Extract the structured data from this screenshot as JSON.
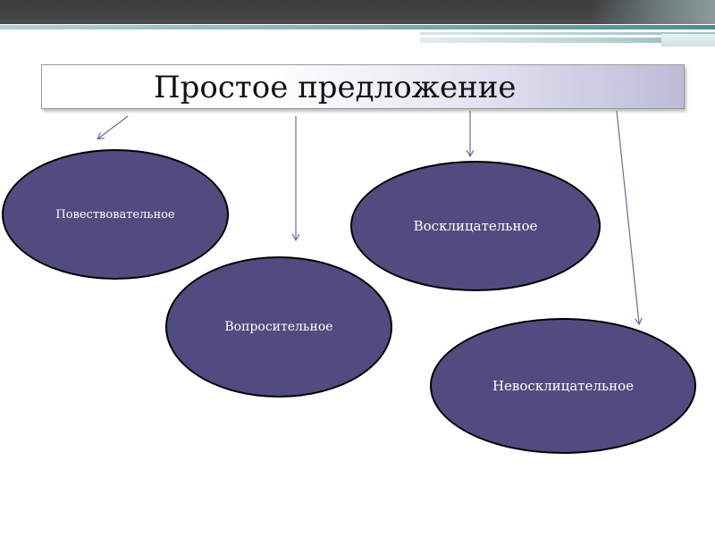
{
  "title": "Простое предложение",
  "nodes": [
    {
      "label": "Повествовательное"
    },
    {
      "label": "Вопросительное"
    },
    {
      "label": "Восклицательное"
    },
    {
      "label": "Невосклицательное"
    }
  ],
  "colors": {
    "node_fill": "#514c80",
    "node_border": "#000000",
    "node_text": "#ffffff",
    "arrow": "#6a6a9a",
    "top_band": "#3c3c3c",
    "accent_teal": "#6fa0a5"
  }
}
